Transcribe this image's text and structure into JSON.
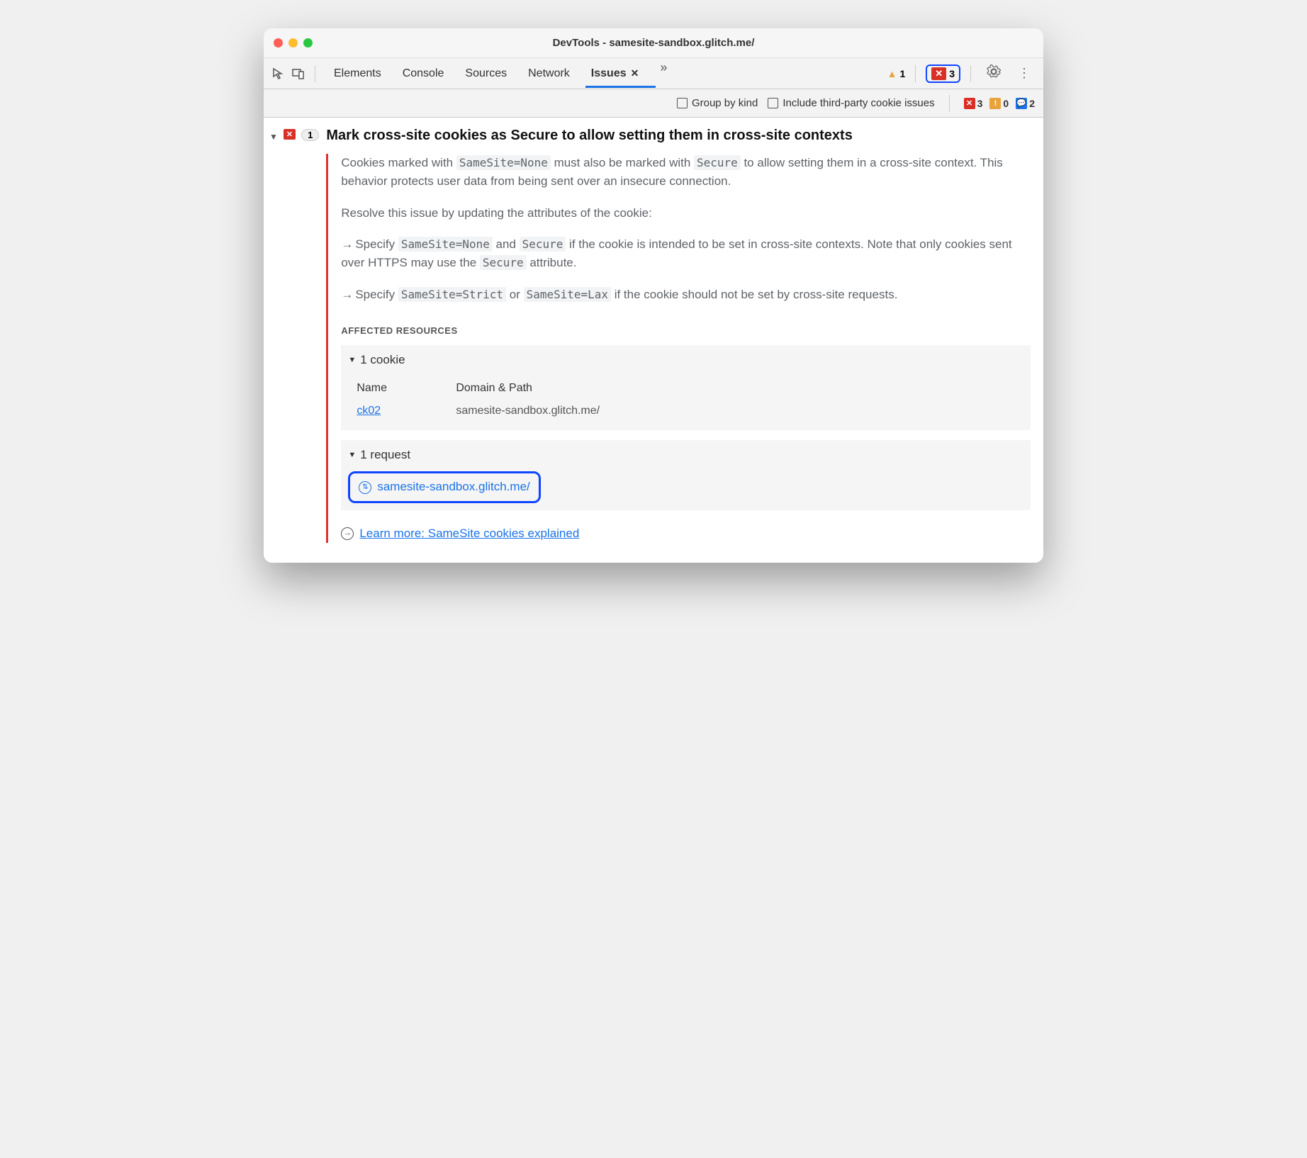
{
  "window_title": "DevTools - samesite-sandbox.glitch.me/",
  "tabs": [
    "Elements",
    "Console",
    "Sources",
    "Network",
    "Issues"
  ],
  "active_tab": "Issues",
  "toolbar_counts": {
    "warning": "1",
    "error": "3"
  },
  "filters": {
    "group_by_kind": "Group by kind",
    "third_party": "Include third-party cookie issues"
  },
  "filter_counts": {
    "err": "3",
    "warn": "0",
    "info": "2"
  },
  "issue": {
    "count": "1",
    "title": "Mark cross-site cookies as Secure to allow setting them in cross-site contexts",
    "p1a": "Cookies marked with ",
    "p1b": " must also be marked with ",
    "p1c": " to allow setting them in a cross-site context. This behavior protects user data from being sent over an insecure connection.",
    "p2": "Resolve this issue by updating the attributes of the cookie:",
    "b1a": "Specify ",
    "b1b": " and ",
    "b1c": " if the cookie is intended to be set in cross-site contexts. Note that only cookies sent over HTTPS may use the ",
    "b1d": " attribute.",
    "b2a": "Specify ",
    "b2b": " or ",
    "b2c": " if the cookie should not be set by cross-site requests.",
    "code": {
      "ssnone": "SameSite=None",
      "secure": "Secure",
      "ssstrict": "SameSite=Strict",
      "sslax": "SameSite=Lax"
    },
    "affected_header": "Affected Resources",
    "cookie_section": "1 cookie",
    "col_name": "Name",
    "col_domain": "Domain & Path",
    "cookie_name": "ck02",
    "cookie_domain": "samesite-sandbox.glitch.me/",
    "request_section": "1 request",
    "request_url": "samesite-sandbox.glitch.me/",
    "learn_more": "Learn more: SameSite cookies explained"
  }
}
